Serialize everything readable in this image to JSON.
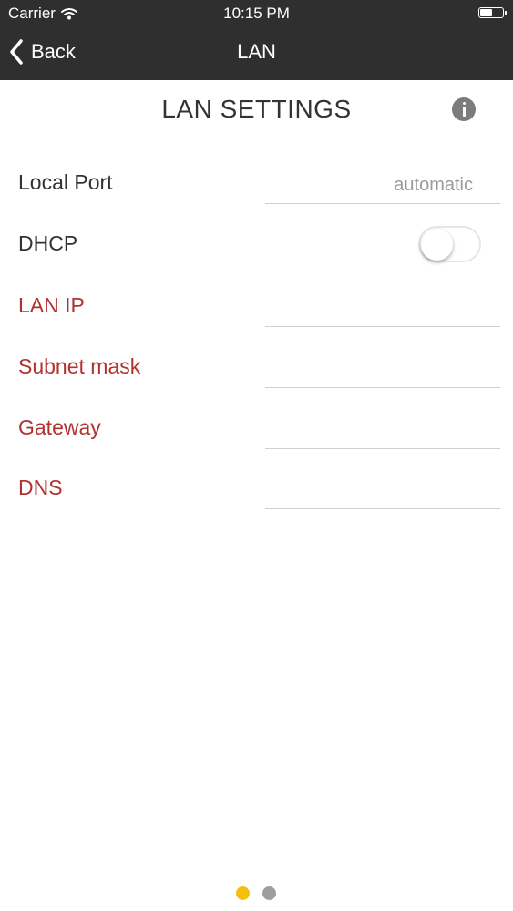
{
  "status_bar": {
    "carrier": "Carrier",
    "time": "10:15 PM"
  },
  "nav": {
    "back_label": "Back",
    "title": "LAN"
  },
  "section": {
    "title": "LAN SETTINGS"
  },
  "rows": {
    "local_port": {
      "label": "Local Port",
      "placeholder": "automatic",
      "value": ""
    },
    "dhcp": {
      "label": "DHCP",
      "enabled": false
    },
    "lan_ip": {
      "label": "LAN IP",
      "value": ""
    },
    "subnet_mask": {
      "label": "Subnet mask",
      "value": ""
    },
    "gateway": {
      "label": "Gateway",
      "value": ""
    },
    "dns": {
      "label": "DNS",
      "value": ""
    }
  },
  "pager": {
    "count": 2,
    "active_index": 0,
    "active_color": "#f5bf0f",
    "inactive_color": "#9e9e9e"
  },
  "colors": {
    "nav_background": "#2f2f2f",
    "required_label": "#b23131",
    "normal_label": "#333333"
  },
  "icons": {
    "back": "chevron-left-icon",
    "info": "info-icon",
    "wifi": "wifi-icon",
    "battery": "battery-icon"
  }
}
